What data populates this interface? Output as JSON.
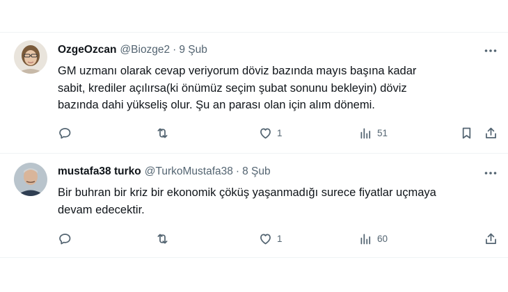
{
  "tweets": [
    {
      "name": "OzgeOzcan",
      "handle": "@Biozge2",
      "separator": "·",
      "date": "9 Şub",
      "lines": [
        "GM uzmanı olarak cevap veriyorum döviz bazında mayıs başına kadar",
        "sabit, krediler açılırsa(ki önümüz seçim şubat sonunu bekleyin) döviz",
        "bazında dahi yükseliş olur. Şu an parası olan için alım dönemi."
      ],
      "likes": "1",
      "views": "51"
    },
    {
      "name": "mustafa38 turko",
      "handle": "@TurkoMustafa38",
      "separator": "·",
      "date": "8 Şub",
      "lines": [
        "Bir buhran bir kriz bir ekonomik çöküş yaşanmadığı surece fiyatlar uçmaya",
        "devam edecektir."
      ],
      "likes": "1",
      "views": "60"
    }
  ],
  "colors": {
    "text": "#0f1419",
    "secondary": "#536471",
    "divider": "#eff3f4"
  },
  "icons": [
    "more-icon",
    "reply-icon",
    "retweet-icon",
    "like-icon",
    "views-icon",
    "bookmark-icon",
    "share-icon"
  ]
}
